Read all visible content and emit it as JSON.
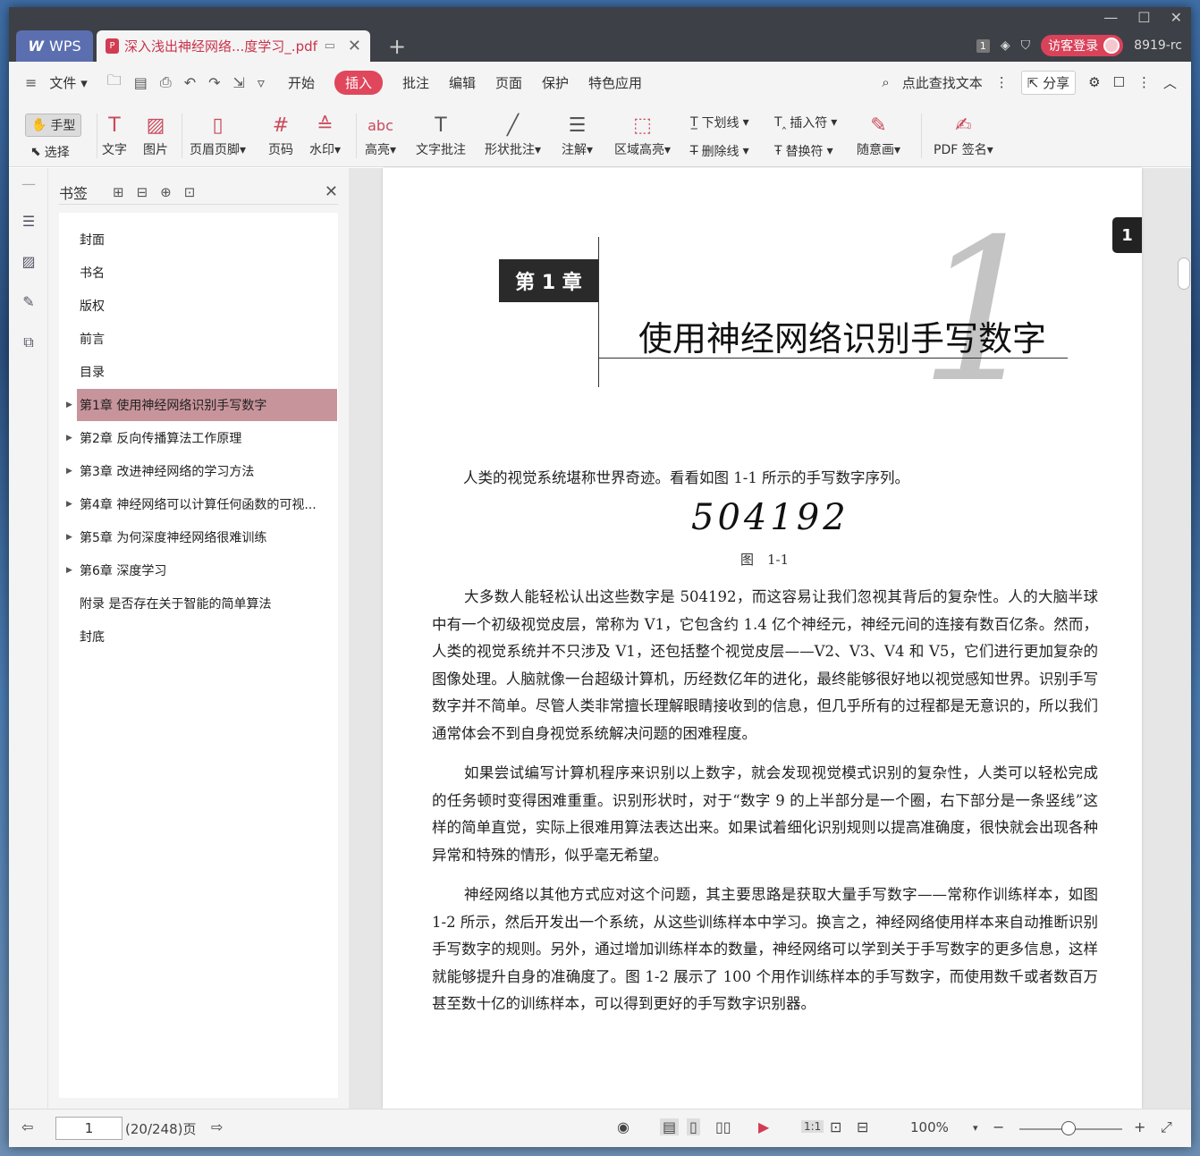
{
  "app": {
    "name": "WPS",
    "doc_tab": "深入浅出神经网络...度学习_.pdf",
    "page_badge": "1",
    "login": "访客登录",
    "user_id": "8919-rc"
  },
  "menu": {
    "file": "文件",
    "items": [
      "开始",
      "插入",
      "批注",
      "编辑",
      "页面",
      "保护",
      "特色应用"
    ],
    "search": "点此查找文本",
    "share": "分享"
  },
  "ribbon": {
    "hand": "手型",
    "select": "选择",
    "text": "文字",
    "image": "图片",
    "header_footer": "页眉页脚",
    "page_number": "页码",
    "watermark": "水印",
    "highlight": "高亮",
    "text_comment": "文字批注",
    "shape_comment": "形状批注",
    "annotation": "注解",
    "area_highlight": "区域高亮",
    "underline": "下划线",
    "strikethrough": "删除线",
    "insert_mark": "插入符",
    "replace_mark": "替换符",
    "freehand": "随意画",
    "pdf_sign": "PDF 签名"
  },
  "panel": {
    "title": "书签",
    "bookmarks": [
      {
        "label": "封面",
        "expandable": false
      },
      {
        "label": "书名",
        "expandable": false
      },
      {
        "label": "版权",
        "expandable": false
      },
      {
        "label": "前言",
        "expandable": false
      },
      {
        "label": "目录",
        "expandable": false
      },
      {
        "label": "第1章 使用神经网络识别手写数字",
        "expandable": true,
        "selected": true
      },
      {
        "label": "第2章 反向传播算法工作原理",
        "expandable": true
      },
      {
        "label": "第3章 改进神经网络的学习方法",
        "expandable": true
      },
      {
        "label": "第4章 神经网络可以计算任何函数的可视...",
        "expandable": true
      },
      {
        "label": "第5章 为何深度神经网络很难训练",
        "expandable": true
      },
      {
        "label": "第6章 深度学习",
        "expandable": true
      },
      {
        "label": "附录 是否存在关于智能的简单算法",
        "expandable": false
      },
      {
        "label": "封底",
        "expandable": false
      }
    ]
  },
  "page": {
    "chapter_label": "第 1 章",
    "chapter_number": "1",
    "chapter_title": "使用神经网络识别手写数字",
    "side_page_number": "1",
    "intro": "人类的视觉系统堪称世界奇迹。看看如图 1-1 所示的手写数字序列。",
    "handwriting": "504192",
    "figure_caption": "图　1-1",
    "paragraphs": [
      "大多数人能轻松认出这些数字是 504192，而这容易让我们忽视其背后的复杂性。人的大脑半球中有一个初级视觉皮层，常称为 V1，它包含约 1.4 亿个神经元，神经元间的连接有数百亿条。然而，人类的视觉系统并不只涉及 V1，还包括整个视觉皮层——V2、V3、V4 和 V5，它们进行更加复杂的图像处理。人脑就像一台超级计算机，历经数亿年的进化，最终能够很好地以视觉感知世界。识别手写数字并不简单。尽管人类非常擅长理解眼睛接收到的信息，但几乎所有的过程都是无意识的，所以我们通常体会不到自身视觉系统解决问题的困难程度。",
      "如果尝试编写计算机程序来识别以上数字，就会发现视觉模式识别的复杂性，人类可以轻松完成的任务顿时变得困难重重。识别形状时，对于“数字 9 的上半部分是一个圈，右下部分是一条竖线”这样的简单直觉，实际上很难用算法表达出来。如果试着细化识别规则以提高准确度，很快就会出现各种异常和特殊的情形，似乎毫无希望。",
      "神经网络以其他方式应对这个问题，其主要思路是获取大量手写数字——常称作训练样本，如图 1-2 所示，然后开发出一个系统，从这些训练样本中学习。换言之，神经网络使用样本来自动推断识别手写数字的规则。另外，通过增加训练样本的数量，神经网络可以学到关于手写数字的更多信息，这样就能够提升自身的准确度了。图 1-2 展示了 100 个用作训练样本的手写数字，而使用数千或者数百万甚至数十亿的训练样本，可以得到更好的手写数字识别器。"
    ]
  },
  "status": {
    "current_page": "1",
    "page_info": "(20/248)页",
    "zoom": "100%",
    "zoom_fraction": 0.5
  }
}
